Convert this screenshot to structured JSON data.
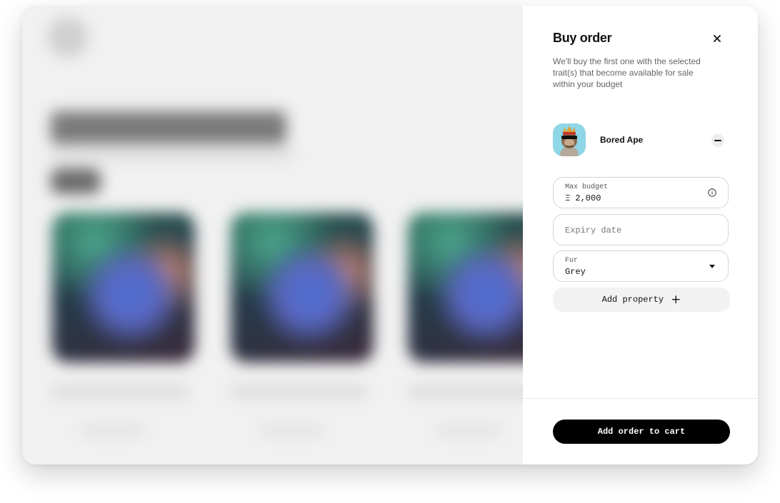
{
  "panel": {
    "title": "Buy order",
    "description": "We'll buy the first one with the selected trait(s) that become available for sale within your budget"
  },
  "collection": {
    "name": "Bored Ape"
  },
  "budget": {
    "label": "Max budget",
    "value": "Ξ 2,000"
  },
  "expiry": {
    "placeholder": "Expiry date"
  },
  "trait": {
    "label": "Fur",
    "value": "Grey"
  },
  "add_property": {
    "label": "Add property"
  },
  "cart": {
    "label": "Add order to cart"
  },
  "icons": {
    "close": "close-icon",
    "remove": "minus-icon",
    "info": "info-icon",
    "caret": "caret-down-icon",
    "plus": "plus-icon"
  }
}
